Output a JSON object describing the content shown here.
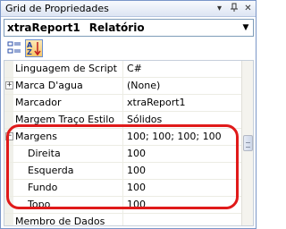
{
  "window": {
    "title": "Grid de Propriedades",
    "icons": [
      "pin-icon",
      "dropdown-icon",
      "close-icon"
    ]
  },
  "selector": {
    "object_name": "xtraReport1",
    "object_type": "Relatório"
  },
  "toolbar": {
    "categorized_icon": "categorized-icon",
    "alphabetical_icon": "alphabetical-sort-icon"
  },
  "properties": [
    {
      "name": "Linguagem de Script",
      "value": "C#"
    },
    {
      "name": "Marca D'agua",
      "value": "(None)",
      "expander": "+"
    },
    {
      "name": "Marcador",
      "value": "xtraReport1"
    },
    {
      "name": "Margem Traço Estilo",
      "value": "Sólidos"
    },
    {
      "name": "Margens",
      "value": "100; 100; 100; 100",
      "expander": "−"
    },
    {
      "name": "Direita",
      "value": "100"
    },
    {
      "name": "Esquerda",
      "value": "100"
    },
    {
      "name": "Fundo",
      "value": "100"
    },
    {
      "name": "Topo",
      "value": "100"
    },
    {
      "name": "Membro de Dados",
      "value": ""
    }
  ],
  "colors": {
    "highlight": "#e01a1a",
    "frame": "#7a96c8"
  }
}
